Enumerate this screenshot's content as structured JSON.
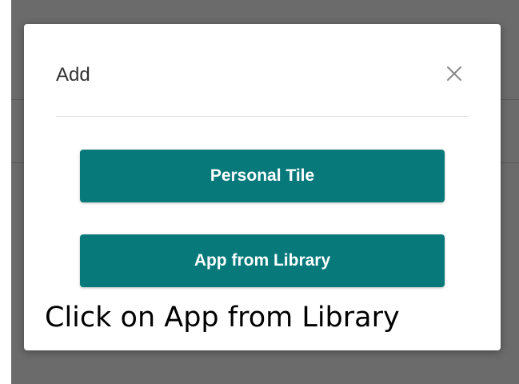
{
  "dialog": {
    "title": "Add",
    "close_icon": "close-icon",
    "buttons": {
      "personal_tile": "Personal Tile",
      "app_from_library": "App from Library"
    },
    "button_color": "#08797a"
  },
  "instruction": {
    "caption": "Click on App from Library"
  }
}
